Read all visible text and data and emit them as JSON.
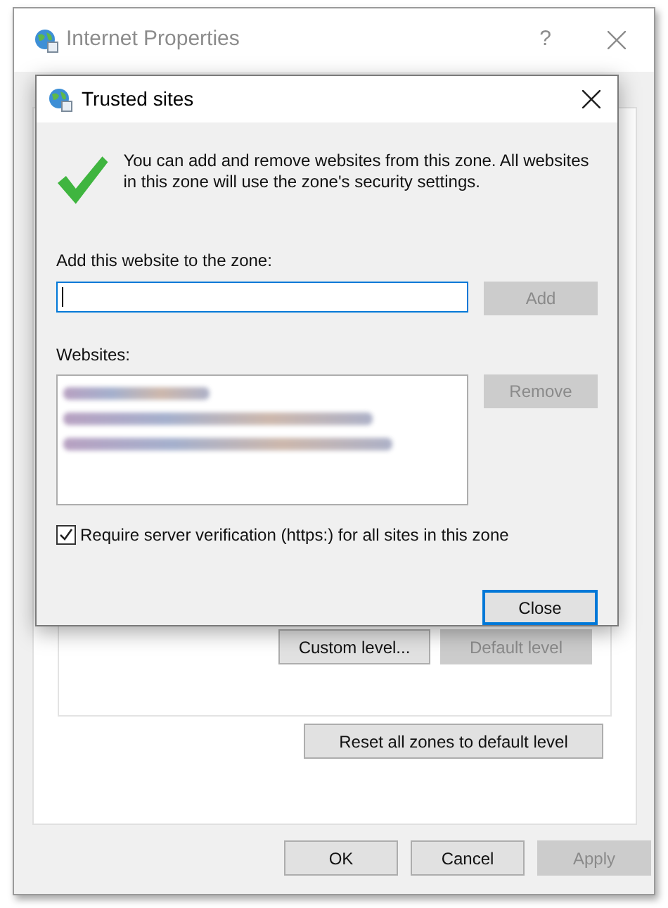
{
  "main_window": {
    "title": "Internet Properties",
    "help": "?",
    "active": false
  },
  "zone_buttons": [
    {
      "label": "Custom level...",
      "disabled": false
    },
    {
      "label": "Default level",
      "disabled": true
    }
  ],
  "reset_button": {
    "label": "Reset all zones to default level",
    "disabled": false
  },
  "footer_buttons": [
    {
      "label": "OK",
      "disabled": false
    },
    {
      "label": "Cancel",
      "disabled": false
    },
    {
      "label": "Apply",
      "disabled": true
    }
  ],
  "dialog": {
    "title": "Trusted sites",
    "message": "You can add and remove websites from this zone. All websites in this zone will use the zone's security settings.",
    "add_label": "Add this website to the zone:",
    "add_button": {
      "label": "Add",
      "disabled": true
    },
    "websites_label": "Websites:",
    "remove_button": {
      "label": "Remove",
      "disabled": true
    },
    "require_https": {
      "label": "Require server verification (https:) for all sites in this zone",
      "checked": true
    },
    "close_button": {
      "label": "Close",
      "disabled": false,
      "default": true
    }
  }
}
